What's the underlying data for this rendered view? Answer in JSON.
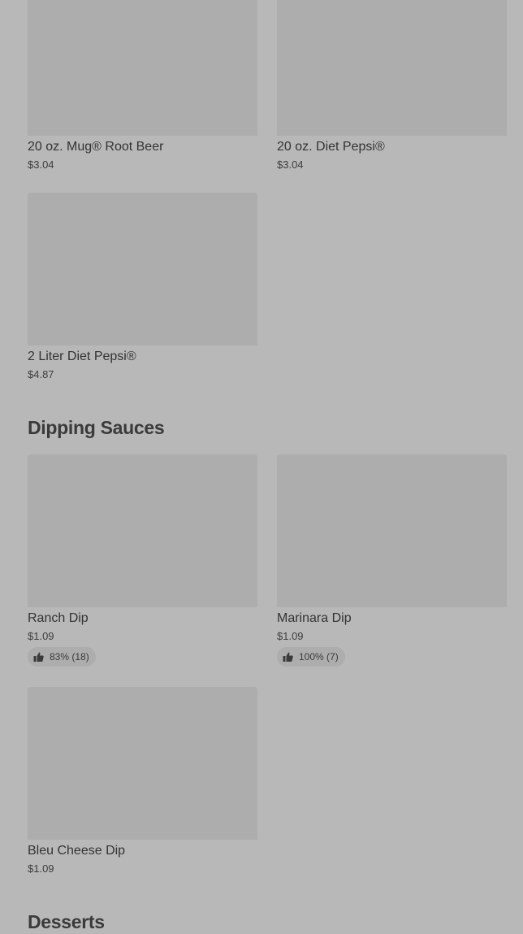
{
  "beverages": {
    "items": [
      {
        "name": "20 oz. Mug® Root Beer",
        "price": "$3.04"
      },
      {
        "name": "20 oz. Diet Pepsi®",
        "price": "$3.04"
      },
      {
        "name": "2 Liter Diet Pepsi®",
        "price": "$4.87"
      }
    ]
  },
  "dipping_sauces": {
    "title": "Dipping Sauces",
    "items": [
      {
        "name": "Ranch Dip",
        "price": "$1.09",
        "rating": "83% (18)"
      },
      {
        "name": "Marinara Dip",
        "price": "$1.09",
        "rating": "100% (7)"
      },
      {
        "name": "Bleu Cheese Dip",
        "price": "$1.09"
      }
    ]
  },
  "desserts": {
    "title": "Desserts"
  },
  "icons": {
    "rating": "thumbs-up-icon"
  },
  "colors": {
    "overlay_background": "#b8b8b8",
    "image_placeholder": "#adadad",
    "text": "#333333"
  }
}
